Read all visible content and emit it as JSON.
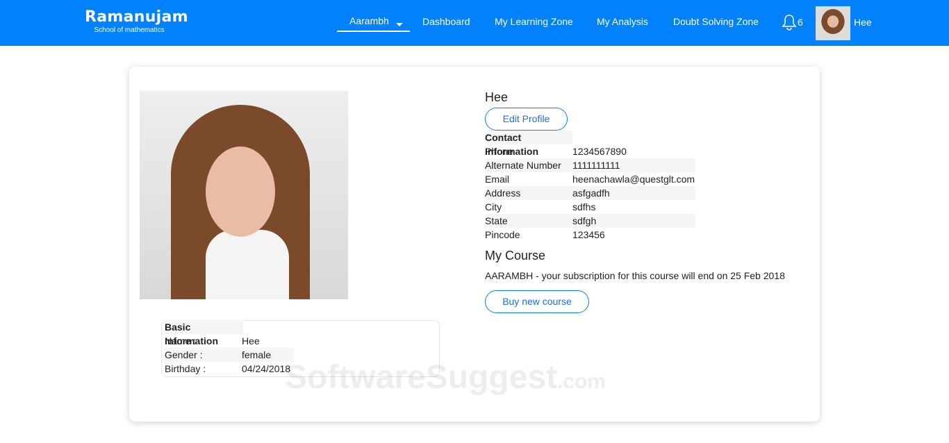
{
  "nav": {
    "logo_title": "Ramanujam",
    "logo_subtitle": "School of mathematics",
    "items": [
      "Aarambh",
      "Dashboard",
      "My Learning Zone",
      "My Analysis",
      "Doubt Solving Zone"
    ],
    "notification_count": "6",
    "user_name": "Hee"
  },
  "profile": {
    "name": "Hee",
    "edit_label": "Edit Profile",
    "contact_title": "Contact Information",
    "contact": [
      {
        "k": "Phone",
        "v": "1234567890"
      },
      {
        "k": "Alternate Number",
        "v": "1111111111"
      },
      {
        "k": "Email",
        "v": "heenachawla@questglt.com"
      },
      {
        "k": "Address",
        "v": "asfgadfh"
      },
      {
        "k": "City",
        "v": "sdfhs"
      },
      {
        "k": "State",
        "v": "sdfgh"
      },
      {
        "k": "Pincode",
        "v": "123456"
      }
    ],
    "course_title": "My Course",
    "course_text": "AARAMBH - your subscription for this course will end on 25 Feb 2018",
    "buy_label": "Buy new course"
  },
  "basic": {
    "title": "Basic Information",
    "rows": [
      {
        "k": "Name :",
        "v": "Hee"
      },
      {
        "k": "Gender :",
        "v": "female"
      },
      {
        "k": "Birthday :",
        "v": "04/24/2018"
      }
    ]
  },
  "watermark": {
    "main": "SoftwareSuggest",
    "suffix": ".com"
  },
  "colors": {
    "brand": "#0281fd"
  }
}
